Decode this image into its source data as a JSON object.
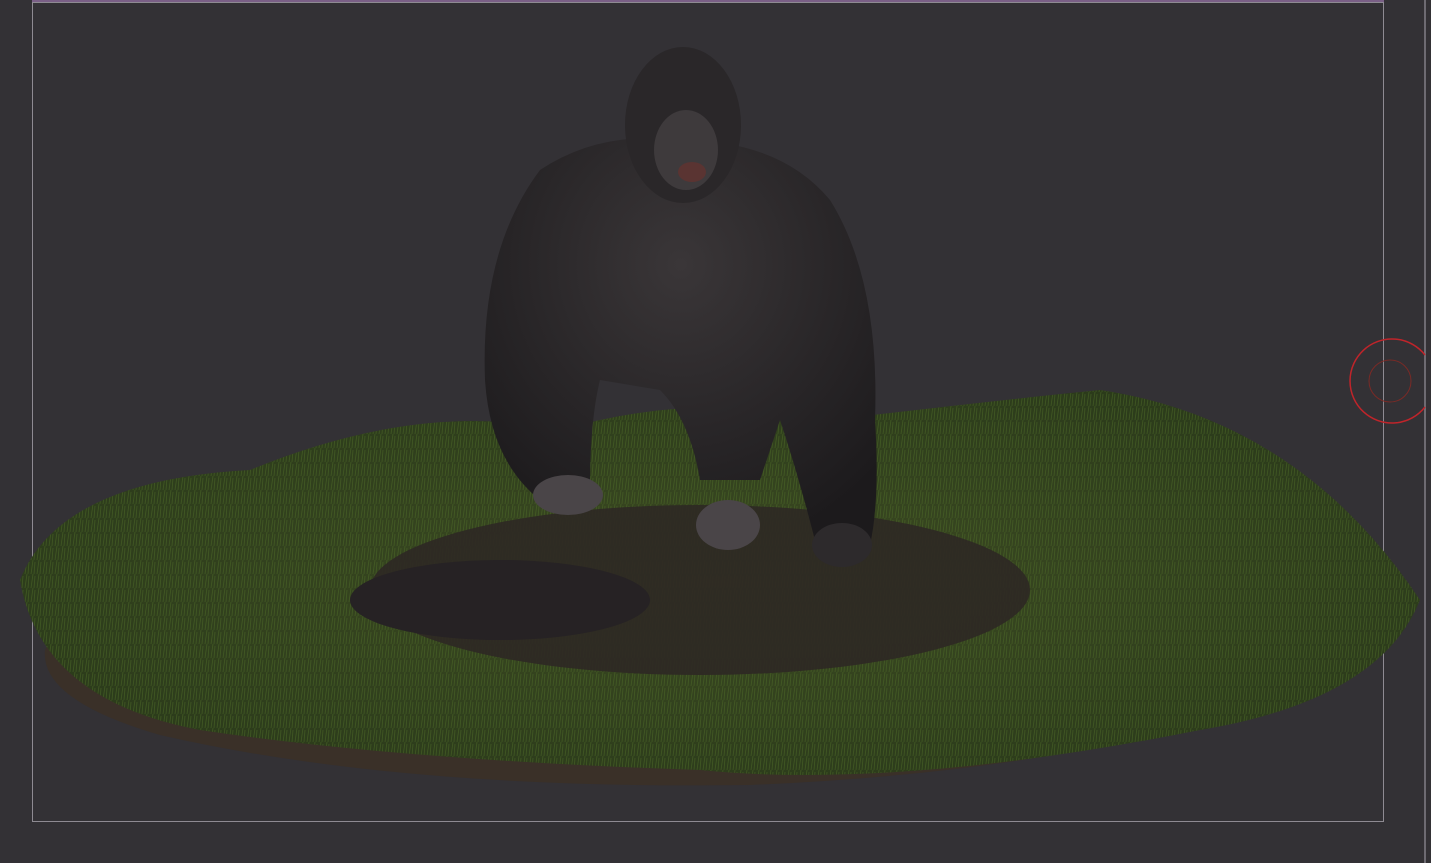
{
  "viewport": {
    "background_color": "#333135",
    "frame_color": "#8e8a92",
    "gizmo_color": "#c0242a",
    "scene_objects": [
      "gorilla-model",
      "grass-patch",
      "ground-base"
    ],
    "gizmo_icon": "navigation-orbit-icon"
  }
}
